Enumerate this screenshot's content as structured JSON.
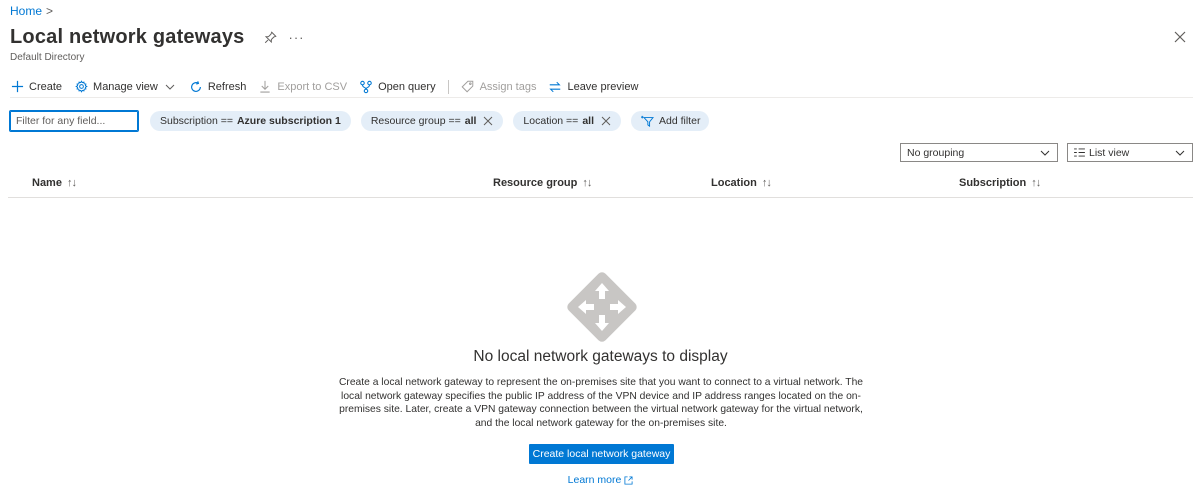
{
  "breadcrumb": {
    "home": "Home",
    "separator": ">"
  },
  "header": {
    "title": "Local network gateways",
    "subtitle": "Default Directory",
    "more": "···"
  },
  "toolbar": {
    "create": "Create",
    "manage_view": "Manage view",
    "refresh": "Refresh",
    "export_csv": "Export to CSV",
    "open_query": "Open query",
    "assign_tags": "Assign tags",
    "leave_preview": "Leave preview"
  },
  "filters": {
    "search_placeholder": "Filter for any field...",
    "subscription_label": "Subscription ==",
    "subscription_value": "Azure subscription 1",
    "resource_group_label": "Resource group ==",
    "resource_group_value": "all",
    "location_label": "Location ==",
    "location_value": "all",
    "add_filter": "Add filter"
  },
  "view_controls": {
    "grouping": "No grouping",
    "view": "List view"
  },
  "columns": {
    "name": "Name",
    "resource_group": "Resource group",
    "location": "Location",
    "subscription": "Subscription",
    "sort_glyph": "↑↓"
  },
  "empty_state": {
    "title": "No local network gateways to display",
    "description": "Create a local network gateway to represent the on-premises site that you want to connect to a virtual network. The local network gateway specifies the public IP address of the VPN device and IP address ranges located on the on-premises site. Later, create a VPN gateway connection between the virtual network gateway for the virtual network, and the local network gateway for the on-premises site.",
    "create_button": "Create local network gateway",
    "learn_more": "Learn more"
  },
  "colors": {
    "accent": "#0078d4",
    "pill_bg": "#e4eef8",
    "icon_gray": "#c8c6c4"
  }
}
